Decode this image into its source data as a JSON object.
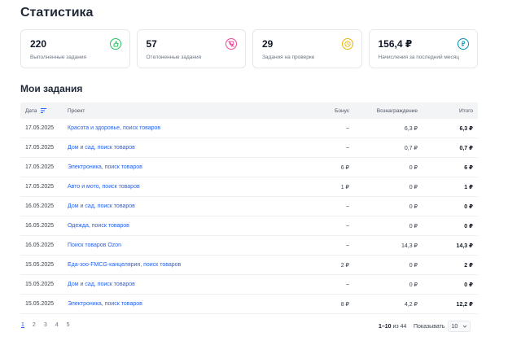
{
  "title": "Статистика",
  "stats": [
    {
      "value": "220",
      "label": "Выполненные задания",
      "icon": "thumbs-up-icon",
      "color": "#22c55e"
    },
    {
      "value": "57",
      "label": "Отклоненные задания",
      "icon": "thumbs-down-icon",
      "color": "#ec4899"
    },
    {
      "value": "29",
      "label": "Задания на проверке",
      "icon": "clock-icon",
      "color": "#eab308"
    },
    {
      "value": "156,4 ₽",
      "label": "Начисления за последний месяц",
      "icon": "ruble-coin-icon",
      "color": "#0891b2"
    }
  ],
  "tasks": {
    "title": "Мои задания",
    "columns": {
      "date": "Дата",
      "project": "Проект",
      "bonus": "Бонус",
      "reward": "Вознаграждение",
      "total": "Итого"
    },
    "rows": [
      {
        "date": "17.05.2025",
        "project": "Красота и здоровье, поиск товаров",
        "bonus": "–",
        "reward": "6,3 ₽",
        "total": "6,3 ₽"
      },
      {
        "date": "17.05.2025",
        "project": "Дом и сад, поиск товаров",
        "bonus": "–",
        "reward": "0,7 ₽",
        "total": "0,7 ₽"
      },
      {
        "date": "17.05.2025",
        "project": "Электроника, поиск товаров",
        "bonus": "6 ₽",
        "reward": "0 ₽",
        "total": "6 ₽"
      },
      {
        "date": "17.05.2025",
        "project": "Авто и мото, поиск товаров",
        "bonus": "1 ₽",
        "reward": "0 ₽",
        "total": "1 ₽"
      },
      {
        "date": "16.05.2025",
        "project": "Дом и сад, поиск товаров",
        "bonus": "–",
        "reward": "0 ₽",
        "total": "0 ₽"
      },
      {
        "date": "16.05.2025",
        "project": "Одежда, поиск товаров",
        "bonus": "–",
        "reward": "0 ₽",
        "total": "0 ₽"
      },
      {
        "date": "16.05.2025",
        "project": "Поиск товаров Ozon",
        "bonus": "–",
        "reward": "14,3 ₽",
        "total": "14,3 ₽"
      },
      {
        "date": "15.05.2025",
        "project": "Еда-зоо-FMCG-канцелярия, поиск товаров",
        "bonus": "2 ₽",
        "reward": "0 ₽",
        "total": "2 ₽"
      },
      {
        "date": "15.05.2025",
        "project": "Дом и сад, поиск товаров",
        "bonus": "–",
        "reward": "0 ₽",
        "total": "0 ₽"
      },
      {
        "date": "15.05.2025",
        "project": "Электроника, поиск товаров",
        "bonus": "8 ₽",
        "reward": "4,2 ₽",
        "total": "12,2 ₽"
      }
    ]
  },
  "pagination": {
    "pages": [
      "1",
      "2",
      "3",
      "4",
      "5"
    ],
    "current": "1",
    "range": "1–10",
    "of_label": "из",
    "total": "44",
    "show_label": "Показывать",
    "page_size": "10"
  }
}
